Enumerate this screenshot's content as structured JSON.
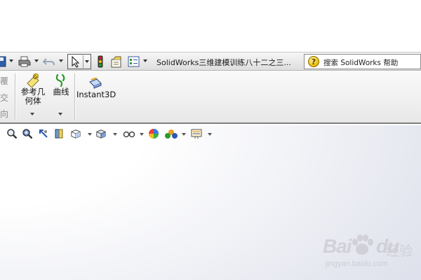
{
  "titlebar": {
    "document_title": "SolidWorks三维建模训练八十二之三...",
    "search_placeholder": "搜索 SolidWorks 帮助",
    "search_icon_glyph": "?"
  },
  "ribbon": {
    "partial_labels": [
      "覆",
      "交",
      "向"
    ],
    "buttons": [
      {
        "label_line1": "参考几",
        "label_line2": "何体"
      },
      {
        "label_line1": "曲线"
      },
      {
        "label_line1": "Instant3D"
      }
    ]
  },
  "watermark": {
    "brand": "Bai",
    "brand_suffix": "du",
    "cn": "经验",
    "url": "jingyan.baidu.com"
  },
  "colors": {
    "accent_green": "#2a9a2a",
    "traffic_red": "#d42020",
    "traffic_yellow": "#e8c000",
    "traffic_green": "#1aa030"
  }
}
